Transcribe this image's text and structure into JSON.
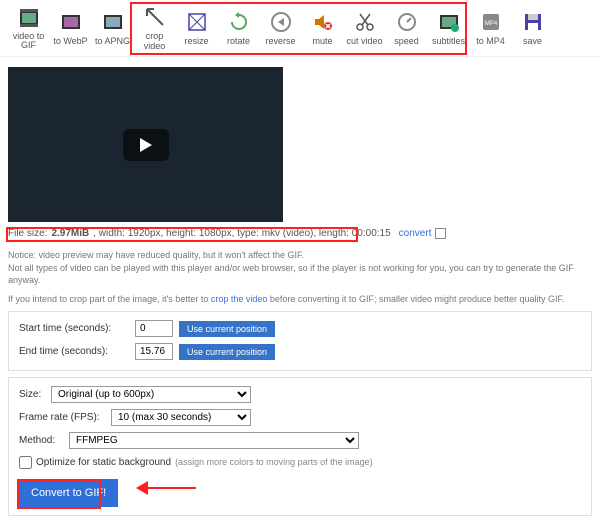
{
  "toolbar": [
    {
      "name": "video-to-gif",
      "label": "video to\nGIF"
    },
    {
      "name": "to-webp",
      "label": "to WebP"
    },
    {
      "name": "to-apng",
      "label": "to APNG"
    },
    {
      "name": "crop-video",
      "label": "crop video"
    },
    {
      "name": "resize",
      "label": "resize"
    },
    {
      "name": "rotate",
      "label": "rotate"
    },
    {
      "name": "reverse",
      "label": "reverse"
    },
    {
      "name": "mute",
      "label": "mute"
    },
    {
      "name": "cut-video",
      "label": "cut video"
    },
    {
      "name": "speed",
      "label": "speed"
    },
    {
      "name": "subtitles",
      "label": "subtitles"
    },
    {
      "name": "to-mp4",
      "label": "to MP4"
    },
    {
      "name": "save",
      "label": "save"
    }
  ],
  "fileinfo": {
    "prefix": "File size: ",
    "size": "2.97MiB",
    "rest": ", width: 1920px, height: 1080px, type: mkv (video), length: 00:00:15",
    "convert": "convert"
  },
  "notices": {
    "p1": "Notice: video preview may have reduced quality, but it won't affect the GIF.",
    "p2": "Not all types of video can be played with this player and/or web browser, so if the player is not working for you, you can try to generate the GIF anyway.",
    "p3a": "If you intend to crop part of the image, it's better to ",
    "p3link": "crop the video",
    "p3b": " before converting it to GIF; smaller video might produce better quality GIF."
  },
  "form": {
    "start_label": "Start time (seconds):",
    "start_val": "0",
    "end_label": "End time (seconds):",
    "end_val": "15.76",
    "use_pos": "Use current position",
    "size_label": "Size:",
    "size_val": "Original (up to 600px)",
    "fps_label": "Frame rate (FPS):",
    "fps_val": "10 (max 30 seconds)",
    "method_label": "Method:",
    "method_val": "FFMPEG",
    "opt_label": "Optimize for static background",
    "opt_sub": "(assign more colors to moving parts of the image)",
    "submit": "Convert to GIF!"
  }
}
